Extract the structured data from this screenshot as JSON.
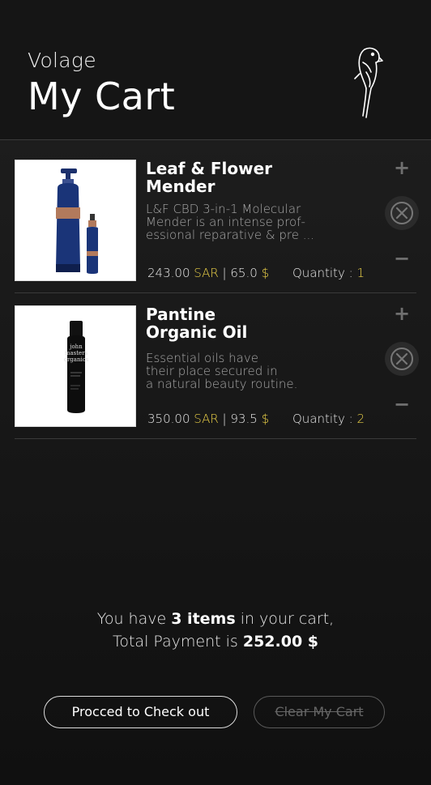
{
  "header": {
    "brand": "Volage",
    "title": "My Cart",
    "logo_icon": "parrot-icon"
  },
  "items": [
    {
      "name_line1": "Leaf & Flower",
      "name_line2": "Mender",
      "desc_lines": [
        "L&F CBD 3-in-1 Molecular",
        "Mender is an intense prof-",
        "essional reparative & pre ..."
      ],
      "price_sar": "243.00",
      "sar_label": "SAR",
      "price_usd": "65.0",
      "usd_label": "$",
      "quantity_label": "Quantity :",
      "quantity": "1",
      "image_icon": "product-bottles-image"
    },
    {
      "name_line1": "Pantine",
      "name_line2": "Organic Oil",
      "desc_lines": [
        "Essential oils have",
        "their place secured in",
        "a natural beauty routine."
      ],
      "price_sar": "350.00",
      "sar_label": "SAR",
      "price_usd": "93.5",
      "usd_label": "$",
      "quantity_label": "Quantity :",
      "quantity": "2",
      "image_icon": "product-bottle-image",
      "bottle_text": [
        "john",
        "masters",
        "organics"
      ]
    }
  ],
  "controls": {
    "plus": "+",
    "minus": "−",
    "remove_icon": "close-icon"
  },
  "summary": {
    "line1_pre": "You have ",
    "line1_bold": "3 items",
    "line1_post": " in your cart,",
    "line2_pre": "Total Payment is ",
    "line2_bold": "252.00 $"
  },
  "buttons": {
    "checkout": "Procced to Check out",
    "clear": "Clear My Cart"
  },
  "colors": {
    "background": "#121212",
    "accent_gold": "#e9cf47",
    "text": "#ffffff",
    "muted": "#a8a8a8"
  }
}
